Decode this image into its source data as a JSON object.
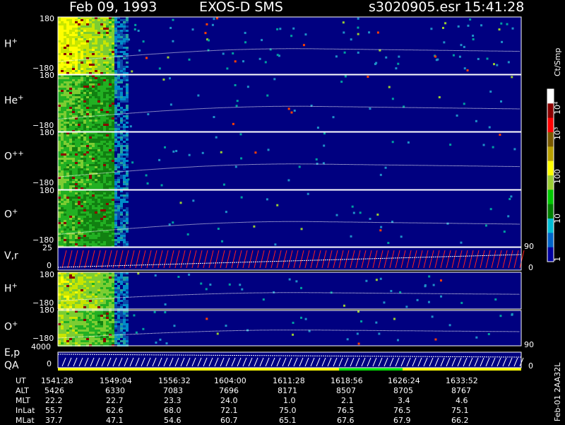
{
  "header": {
    "date": "Feb 09, 1993",
    "instrument": "EXOS-D SMS",
    "file": "s3020905.esr",
    "time": "15:41:28"
  },
  "panels": [
    {
      "label": "H",
      "sup": "+",
      "ytop": "180",
      "ybot": "−180"
    },
    {
      "label": "He",
      "sup": "+",
      "ytop": "180",
      "ybot": "−180"
    },
    {
      "label": "O",
      "sup": "++",
      "ytop": "180",
      "ybot": "−180"
    },
    {
      "label": "O",
      "sup": "+",
      "ytop": "180",
      "ybot": "−180",
      "right_tick": "90"
    },
    {
      "label": "V,r",
      "sup": "",
      "ytop": "25",
      "ybot": "0",
      "right_tick": "0"
    },
    {
      "label": "H",
      "sup": "+",
      "ytop": "180",
      "ybot": "−180"
    },
    {
      "label": "O",
      "sup": "+",
      "ytop": "180",
      "ybot": "−180",
      "right_tick": "90"
    },
    {
      "label": "E,p",
      "sup": "",
      "label2": "QA",
      "ytop": "4000",
      "ybot": "0",
      "right_tick": "0"
    }
  ],
  "colorbar": {
    "title": "Ct/Smp",
    "ticks": [
      "10⁴",
      "10³",
      "100",
      "10",
      "1"
    ],
    "colors": [
      "#ffffff",
      "#8b0000",
      "#ff0000",
      "#7a5a00",
      "#b8a000",
      "#ffff00",
      "#9acd32",
      "#00c800",
      "#008000",
      "#00bcd4",
      "#0064c8",
      "#0000a0"
    ]
  },
  "table": {
    "row_labels": [
      "UT",
      "ALT",
      "MLT",
      "InLat",
      "MLat"
    ],
    "columns": [
      {
        "UT": "1541:28",
        "ALT": "5426",
        "MLT": "22.2",
        "InLat": "55.7",
        "MLat": "37.7"
      },
      {
        "UT": "1549:04",
        "ALT": "6330",
        "MLT": "22.7",
        "InLat": "62.6",
        "MLat": "47.1"
      },
      {
        "UT": "1556:32",
        "ALT": "7083",
        "MLT": "23.3",
        "InLat": "68.0",
        "MLat": "54.6"
      },
      {
        "UT": "1604:00",
        "ALT": "7696",
        "MLT": "24.0",
        "InLat": "72.1",
        "MLat": "60.7"
      },
      {
        "UT": "1611:28",
        "ALT": "8171",
        "MLT": "1.0",
        "InLat": "75.0",
        "MLat": "65.1"
      },
      {
        "UT": "1618:56",
        "ALT": "8507",
        "MLT": "2.1",
        "InLat": "76.5",
        "MLat": "67.6"
      },
      {
        "UT": "1626:24",
        "ALT": "8705",
        "MLT": "3.4",
        "InLat": "76.5",
        "MLat": "67.9"
      },
      {
        "UT": "1633:52",
        "ALT": "8767",
        "MLT": "4.6",
        "InLat": "75.1",
        "MLat": "66.2"
      }
    ]
  },
  "footer_code": "Feb-01 2AA32L",
  "chart_data": {
    "type": "heatmap",
    "title": "Feb 09, 1993   EXOS-D SMS",
    "x_time_ticks": [
      "1541:28",
      "1549:04",
      "1556:32",
      "1604:00",
      "1611:28",
      "1618:56",
      "1626:24",
      "1633:52"
    ],
    "series": [
      {
        "name": "H+",
        "yrange": [
          -180,
          180
        ]
      },
      {
        "name": "He+",
        "yrange": [
          -180,
          180
        ]
      },
      {
        "name": "O++",
        "yrange": [
          -180,
          180
        ]
      },
      {
        "name": "O+",
        "yrange": [
          -180,
          180
        ]
      },
      {
        "name": "V,r",
        "yrange": [
          0,
          25
        ]
      },
      {
        "name": "H+",
        "yrange": [
          -180,
          180
        ]
      },
      {
        "name": "O+",
        "yrange": [
          -180,
          180
        ]
      },
      {
        "name": "E,p",
        "yrange": [
          0,
          4000
        ]
      }
    ],
    "color_scale": {
      "label": "Ct/Smp",
      "min": 1,
      "max": 10000,
      "scale": "log"
    }
  }
}
